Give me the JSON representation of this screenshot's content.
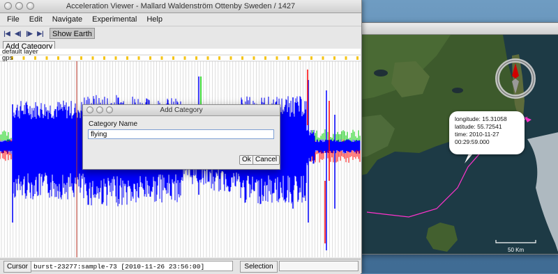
{
  "app": {
    "title": "Acceleration Viewer - Mallard Waldenström Ottenby Sweden / 1427"
  },
  "menu": [
    "File",
    "Edit",
    "Navigate",
    "Experimental",
    "Help"
  ],
  "toolbar": {
    "nav_icons": [
      "skip-to-start-icon",
      "step-back-icon",
      "step-forward-icon",
      "skip-to-end-icon"
    ],
    "show_earth_label": "Show Earth"
  },
  "toolbar2": {
    "add_category_label": "Add Category"
  },
  "plot": {
    "layers": [
      "default layer",
      "gps"
    ],
    "colors": {
      "x_axis": "#0000ff",
      "y_axis": "#ff0000",
      "z_axis": "#00cc00",
      "cursor": "#c0392b",
      "gps_marker": "#f5c518"
    }
  },
  "status": {
    "cursor_label": "Cursor",
    "cursor_value": "burst-23277:sample-73 [2010-11-26 23:56:00]",
    "selection_label": "Selection"
  },
  "dialog": {
    "title": "Add Category",
    "field_label": "Category Name",
    "field_value": "flying",
    "ok_label": "Ok",
    "cancel_label": "Cancel"
  },
  "map": {
    "balloon": {
      "longitude": "longitude: 15.31058",
      "latitude": "latitude: 55.72541",
      "time_line1": "time: 2010-11-27",
      "time_line2": "00:29:59.000"
    },
    "scale_label": "50 Km",
    "track_color": "#ff33cc"
  }
}
